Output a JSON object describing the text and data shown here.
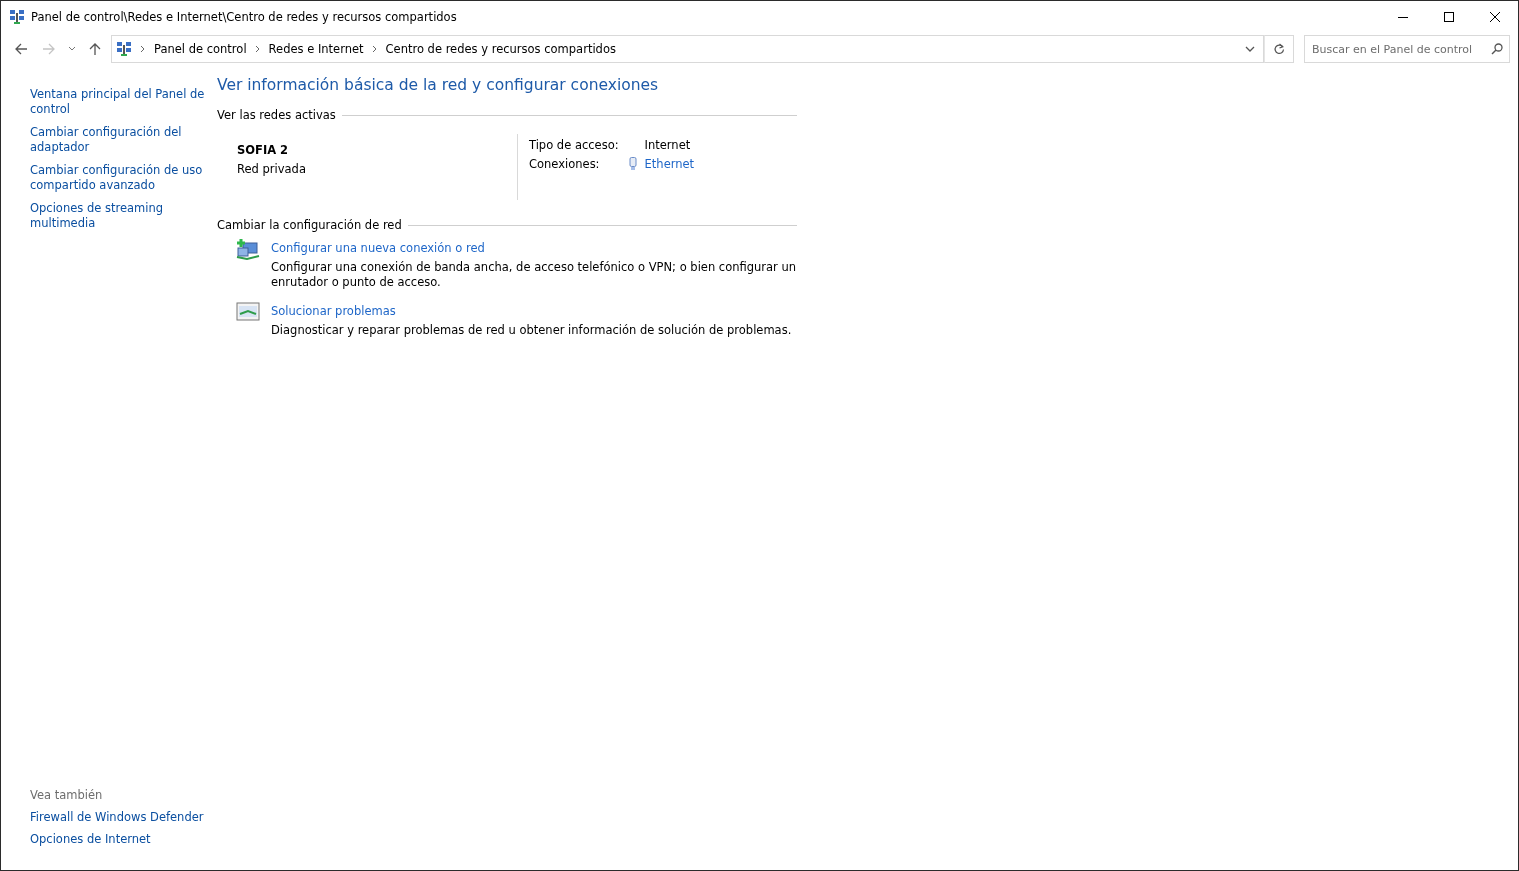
{
  "window": {
    "title": "Panel de control\\Redes e Internet\\Centro de redes y recursos compartidos"
  },
  "address_bar": {
    "crumbs": [
      "Panel de control",
      "Redes e Internet",
      "Centro de redes y recursos compartidos"
    ]
  },
  "search": {
    "placeholder": "Buscar en el Panel de control"
  },
  "sidebar": {
    "links": [
      "Ventana principal del Panel de control",
      "Cambiar configuración del adaptador",
      "Cambiar configuración de uso compartido avanzado",
      "Opciones de streaming multimedia"
    ],
    "see_also_title": "Vea también",
    "see_also": [
      "Firewall de Windows Defender",
      "Opciones de Internet"
    ]
  },
  "main": {
    "heading": "Ver información básica de la red y configurar conexiones",
    "active_title": "Ver las redes activas",
    "network": {
      "name": "SOFIA 2",
      "type": "Red privada",
      "access_label": "Tipo de acceso:",
      "access_value": "Internet",
      "connections_label": "Conexiones:",
      "connection": "Ethernet"
    },
    "change_title": "Cambiar la configuración de red",
    "tasks": [
      {
        "kind": "new",
        "link": "Configurar una nueva conexión o red",
        "description": "Configurar una conexión de banda ancha, de acceso telefónico o VPN; o bien configurar un enrutador o punto de acceso."
      },
      {
        "kind": "troubleshoot",
        "link": "Solucionar problemas",
        "description": "Diagnosticar y reparar problemas de red u obtener información de solución de problemas."
      }
    ]
  }
}
